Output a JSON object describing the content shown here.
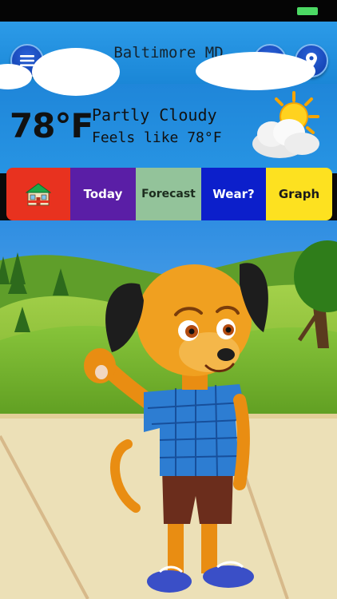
{
  "header": {
    "title": "Baltimore MD",
    "menu_icon": "hamburger-icon",
    "refresh_icon": "refresh-icon",
    "location_icon": "location-pin-icon"
  },
  "weather": {
    "temperature": "78°F",
    "condition": "Partly Cloudy",
    "feels_like": "Feels like 78°F",
    "condition_icon": "partly-cloudy-icon"
  },
  "tabs": [
    {
      "label": "",
      "icon": "house-icon"
    },
    {
      "label": "Today"
    },
    {
      "label": "Forecast"
    },
    {
      "label": "Wear?"
    },
    {
      "label": "Graph"
    }
  ],
  "colors": {
    "header": "#1a86d6",
    "tab_home": "#e8321f",
    "tab_today": "#5a1ea6",
    "tab_forecast": "#93c39a",
    "tab_wear": "#0c1fcb",
    "tab_graph": "#fde120"
  }
}
